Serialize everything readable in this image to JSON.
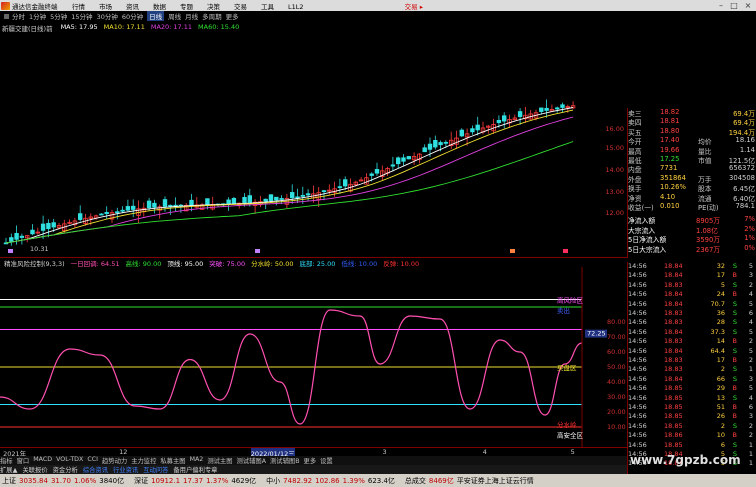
{
  "window": {
    "app_name": "通达信金融终端",
    "menu": [
      "行情",
      "市场",
      "资讯",
      "数据",
      "专题",
      "决策",
      "交易",
      "工具",
      "L1L2"
    ],
    "trade_label": "交易 ▸"
  },
  "periods": [
    "分时",
    "1分钟",
    "5分钟",
    "15分钟",
    "30分钟",
    "60分钟",
    "日线",
    "周线",
    "月线",
    "多周期",
    "更多"
  ],
  "active_period": "日线",
  "ma": {
    "stock_name": "新疆交建(日线)前",
    "items": [
      {
        "label": "MA5: 17.95",
        "color": "#ffffff"
      },
      {
        "label": "MA10: 17.11",
        "color": "#f0e030"
      },
      {
        "label": "MA20: 17.11",
        "color": "#e040e0"
      },
      {
        "label": "MA60: 15.40",
        "color": "#30e030"
      }
    ]
  },
  "price_axis": [
    "16.00",
    "15.00",
    "14.00",
    "13.00",
    "12.00"
  ],
  "low_marker": "10.31",
  "indicator": {
    "name": "精准风险控制(9,3,3)",
    "items": [
      {
        "label": "一日回调: 64.51",
        "color": "#ff50b0"
      },
      {
        "label": "高线: 90.00",
        "color": "#30e030"
      },
      {
        "label": "顶线: 95.00",
        "color": "#ffffff"
      },
      {
        "label": "突破: 75.00",
        "color": "#ff50ff"
      },
      {
        "label": "分水岭: 50.00",
        "color": "#f0e030"
      },
      {
        "label": "底部: 25.00",
        "color": "#30e0ff"
      },
      {
        "label": "低线: 10.00",
        "color": "#3060ff"
      },
      {
        "label": "反弹: 10.00",
        "color": "#ff3030"
      }
    ],
    "axis": [
      "80.00",
      "70.00",
      "60.00",
      "50.00",
      "40.00",
      "30.00",
      "20.00",
      "10.00"
    ],
    "current_value": "72.25",
    "zone_labels": [
      "高风险区",
      "卖出",
      "分水岭",
      "买盘区",
      "高安全区"
    ]
  },
  "quote": [
    {
      "label": "卖三",
      "price": "18.82",
      "vol": "69.4万"
    },
    {
      "label": "卖四",
      "price": "18.81",
      "vol": "69.4万"
    },
    {
      "label": "买五",
      "price": "18.80",
      "vol": "194.4万"
    },
    {
      "label": "今开",
      "price": "17.40",
      "k2": "均价",
      "v2": "18.16"
    },
    {
      "label": "最高",
      "price": "19.66",
      "k2": "量比",
      "v2": "1.14"
    },
    {
      "label": "最低",
      "price": "17.25",
      "k2": "市值",
      "v2": "121.5亿"
    },
    {
      "label": "内盘",
      "price": "7731",
      "k2": "",
      "v2": "656372"
    },
    {
      "label": "外盘",
      "price": "351864",
      "k2": "万手",
      "v2": "304508"
    },
    {
      "label": "换手",
      "price": "10.26%",
      "k2": "股本",
      "v2": "6.45亿"
    },
    {
      "label": "净资",
      "price": "4.10",
      "k2": "流通",
      "v2": "6.40亿"
    },
    {
      "label": "收益(一)",
      "price": "0.010",
      "k2": "PE(动)",
      "v2": "784.1"
    }
  ],
  "flows": [
    {
      "label": "净流入额",
      "value": "8905万",
      "pct": "7%"
    },
    {
      "label": "大宗流入",
      "value": "1.08亿",
      "pct": "2%"
    },
    {
      "label": "5日净流入额",
      "value": "3590万",
      "pct": "1%"
    },
    {
      "label": "5日大宗流入",
      "value": "2367万",
      "pct": "0%"
    }
  ],
  "trades": [
    {
      "time": "14:56",
      "price": "18.84",
      "vol": "32",
      "side": "S",
      "n": "5"
    },
    {
      "time": "14:56",
      "price": "18.84",
      "vol": "17",
      "side": "B",
      "n": "3"
    },
    {
      "time": "14:56",
      "price": "18.83",
      "vol": "5",
      "side": "S",
      "n": "2"
    },
    {
      "time": "14:56",
      "price": "18.84",
      "vol": "24",
      "side": "B",
      "n": "4"
    },
    {
      "time": "14:56",
      "price": "18.84",
      "vol": "70.7",
      "side": "S",
      "n": "5"
    },
    {
      "time": "14:56",
      "price": "18.83",
      "vol": "36",
      "side": "S",
      "n": "6"
    },
    {
      "time": "14:56",
      "price": "18.83",
      "vol": "28",
      "side": "S",
      "n": "4"
    },
    {
      "time": "14:56",
      "price": "18.84",
      "vol": "37.3",
      "side": "S",
      "n": "5"
    },
    {
      "time": "14:56",
      "price": "18.83",
      "vol": "14",
      "side": "B",
      "n": "2"
    },
    {
      "time": "14:56",
      "price": "18.84",
      "vol": "64.4",
      "side": "S",
      "n": "5"
    },
    {
      "time": "14:56",
      "price": "18.83",
      "vol": "17",
      "side": "B",
      "n": "2"
    },
    {
      "time": "14:56",
      "price": "18.83",
      "vol": "2",
      "side": "S",
      "n": "1"
    },
    {
      "time": "14:56",
      "price": "18.84",
      "vol": "66",
      "side": "S",
      "n": "3"
    },
    {
      "time": "14:56",
      "price": "18.85",
      "vol": "29",
      "side": "B",
      "n": "5"
    },
    {
      "time": "14:56",
      "price": "18.85",
      "vol": "13",
      "side": "S",
      "n": "4"
    },
    {
      "time": "14:56",
      "price": "18.85",
      "vol": "51",
      "side": "B",
      "n": "6"
    },
    {
      "time": "14:56",
      "price": "18.85",
      "vol": "26",
      "side": "B",
      "n": "3"
    },
    {
      "time": "14:56",
      "price": "18.85",
      "vol": "2",
      "side": "S",
      "n": "2"
    },
    {
      "time": "14:56",
      "price": "18.86",
      "vol": "10",
      "side": "B",
      "n": "2"
    },
    {
      "time": "14:56",
      "price": "18.85",
      "vol": "6",
      "side": "S",
      "n": "1"
    },
    {
      "time": "14:56",
      "price": "18.84",
      "vol": "5",
      "side": "S",
      "n": "1"
    },
    {
      "time": "14:56",
      "price": "18.84",
      "vol": "5",
      "side": "S",
      "n": "1"
    }
  ],
  "dates": [
    {
      "label": "2021年",
      "pos": 0.005
    },
    {
      "label": "12",
      "pos": 0.19
    },
    {
      "label": "2022/01/12三",
      "pos": 0.4
    },
    {
      "label": "3",
      "pos": 0.61
    },
    {
      "label": "4",
      "pos": 0.77
    },
    {
      "label": "5",
      "pos": 0.91
    }
  ],
  "tabs1": [
    "指标",
    "窗口",
    "MACD",
    "VOL-TDX",
    "CCI",
    "趋势动力",
    "主力监控",
    "私募主图",
    "MA2",
    "测试主图",
    "测试辅图A",
    "测试辅图B",
    "更多",
    "设置"
  ],
  "tabs2": [
    "扩展▲",
    "关联报价",
    "资金分析",
    "综合资讯",
    "行业资讯",
    "互动问答",
    "备用户偏利专章"
  ],
  "status": [
    {
      "name": "上证",
      "val": "3035.84",
      "chg": "31.70",
      "pct": "1.06%",
      "amt": "3840亿"
    },
    {
      "name": "深证",
      "val": "10912.1",
      "chg": "17.37",
      "pct": "1.37%",
      "amt": "4629亿"
    },
    {
      "name": "中小",
      "val": "7482.92",
      "chg": "102.86",
      "pct": "1.39%",
      "amt": "623.4亿"
    },
    {
      "name": "总成交",
      "val": "8469亿",
      "chg": "",
      "pct": "",
      "amt": ""
    }
  ],
  "status_tail": "平安证券上海上证云行情",
  "watermark": "www.7gpzb.com"
}
